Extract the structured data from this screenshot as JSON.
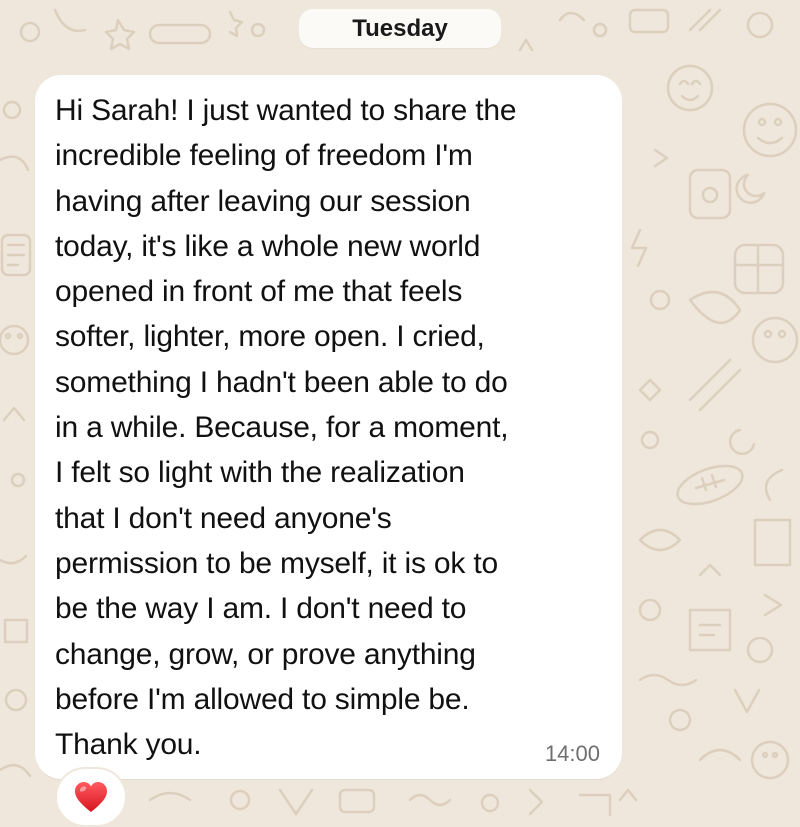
{
  "chat": {
    "date_label": "Tuesday",
    "message": {
      "lines": [
        "Hi Sarah! I just wanted to share the",
        "incredible feeling of freedom I'm",
        "having after leaving our session",
        "today, it's like a whole new world",
        "opened in front of me that feels",
        "softer, lighter, more open. I cried,",
        "something I hadn't been able to do",
        "in a while. Because, for a moment,",
        "I felt so light with the realization",
        "that I don't need anyone's",
        "permission to be myself, it is ok to",
        "be the way I am. I don't need to",
        "change, grow, or prove anything",
        "before I'm allowed to simple be.",
        "Thank you."
      ],
      "time": "14:00",
      "reaction_icon": "red-heart-icon"
    }
  },
  "colors": {
    "wallpaper": "#efe7dc",
    "doodle": "#dccfbd",
    "bubble": "#ffffff",
    "heart": "#e8202e"
  }
}
